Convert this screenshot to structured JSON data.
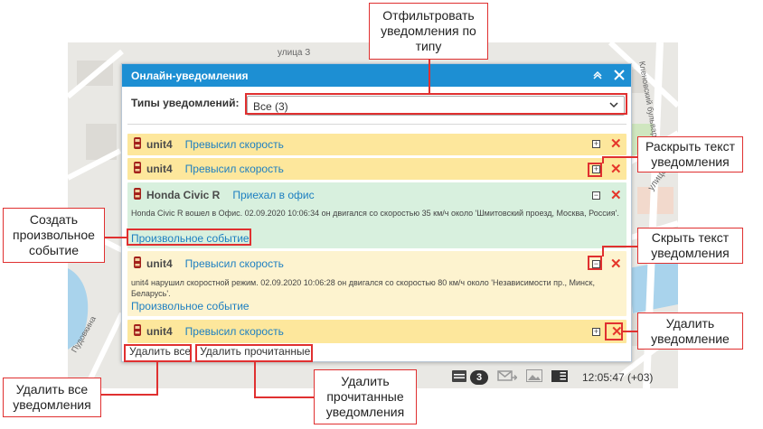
{
  "map": {
    "streets": [
      "улица З",
      "Кленовский бульвар",
      "улица Б",
      "Пудовкина"
    ]
  },
  "window": {
    "title": "Онлайн-уведомления",
    "filter_label": "Типы уведомлений:",
    "filter_value": "Все (3)",
    "notifications": [
      {
        "unit": "unit4",
        "event": "Превысил скорость",
        "state": "collapsed"
      },
      {
        "unit": "unit4",
        "event": "Превысил скорость",
        "state": "collapsed"
      },
      {
        "unit": "Honda Civic R",
        "event": "Приехал в офис",
        "state": "expanded",
        "text": "Honda Civic R вошел в Офис. 02.09.2020 10:06:34 он двигался со скоростью 35 км/ч около 'Шмитовский проезд, Москва, Россия'.",
        "link": "Произвольное событие"
      },
      {
        "unit": "unit4",
        "event": "Превысил скорость",
        "state": "expanded",
        "text": "unit4 нарушил скоростной режим. 02.09.2020 10:06:28 он двигался со скоростью 80 км/ч около 'Независимости пр., Минск, Беларусь'.",
        "link": "Произвольное событие"
      },
      {
        "unit": "unit4",
        "event": "Превысил скорость",
        "state": "collapsed"
      }
    ],
    "delete_all": "Удалить все",
    "delete_read": "Удалить прочитанные"
  },
  "statusbar": {
    "badge": "3",
    "time": "12:05:47 (+03)"
  },
  "callouts": {
    "filter": "Отфильтровать уведомления по типу",
    "expand": "Раскрыть текст уведомления",
    "custom_event": "Создать произвольное событие",
    "collapse": "Скрыть текст уведомления",
    "delete_one": "Удалить уведомление",
    "delete_all": "Удалить все уведомления",
    "delete_read": "Удалить прочитанные уведомления"
  }
}
